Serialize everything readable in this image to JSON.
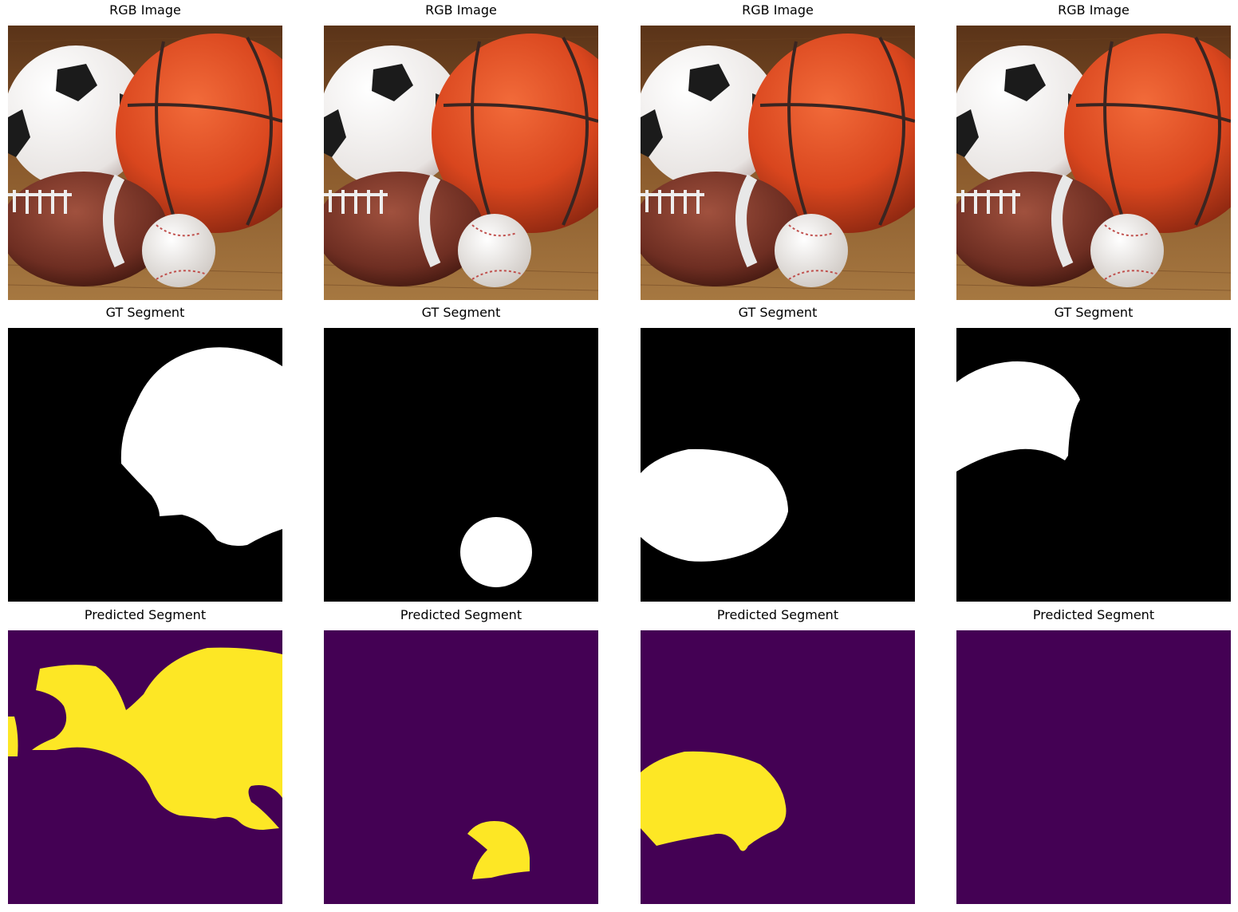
{
  "titles": {
    "rgb": "RGB Image",
    "gt": "GT Segment",
    "pred": "Predicted Segment"
  },
  "colors": {
    "mask_background": "#000000",
    "mask_foreground": "#ffffff",
    "pred_background": "#440154",
    "pred_foreground": "#fde725"
  },
  "photo_description_icons": [
    "soccer-ball",
    "basketball",
    "american-football",
    "baseball",
    "wooden-floor"
  ]
}
